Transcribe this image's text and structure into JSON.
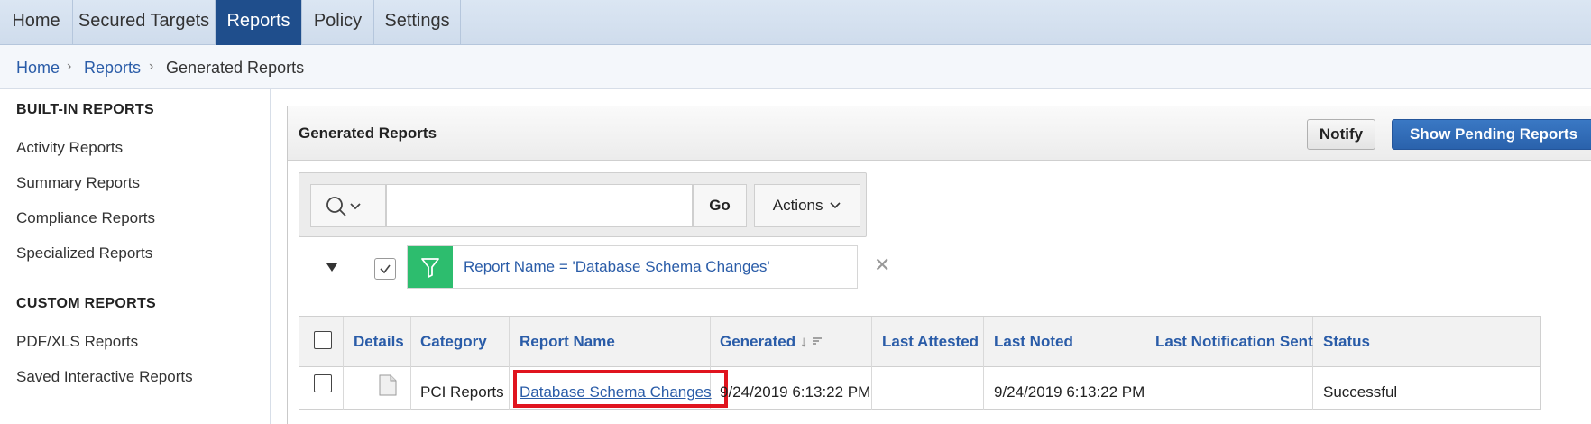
{
  "nav": {
    "tabs": [
      {
        "label": "Home",
        "active": false
      },
      {
        "label": "Secured Targets",
        "active": false
      },
      {
        "label": "Reports",
        "active": true
      },
      {
        "label": "Policy",
        "active": false
      },
      {
        "label": "Settings",
        "active": false
      }
    ]
  },
  "breadcrumb": {
    "items": [
      "Home",
      "Reports",
      "Generated Reports"
    ]
  },
  "sidebar": {
    "builtin_heading": "BUILT-IN REPORTS",
    "builtin_items": [
      "Activity Reports",
      "Summary Reports",
      "Compliance Reports",
      "Specialized Reports"
    ],
    "custom_heading": "CUSTOM REPORTS",
    "custom_items": [
      "PDF/XLS Reports",
      "Saved Interactive Reports"
    ]
  },
  "panel": {
    "title": "Generated Reports",
    "notify_label": "Notify",
    "pending_label": "Show Pending Reports"
  },
  "search": {
    "value": "",
    "go_label": "Go",
    "actions_label": "Actions"
  },
  "filter": {
    "checked": true,
    "text": "Report Name = 'Database Schema Changes'",
    "remove_glyph": "✕"
  },
  "table": {
    "columns": [
      "Details",
      "Category",
      "Report Name",
      "Generated",
      "Last Attested",
      "Last Noted",
      "Last Notification Sent",
      "Status"
    ],
    "sort_glyph": "↓",
    "rows": [
      {
        "category": "PCI Reports",
        "report_name": "Database Schema Changes",
        "generated": "9/24/2019 6:13:22 PM",
        "last_attested": "",
        "last_noted": "9/24/2019 6:13:22 PM",
        "last_notification_sent": "",
        "status": "Successful"
      }
    ]
  },
  "colors": {
    "nav_active": "#1f4e8c",
    "link": "#2a5ca8",
    "primary_button": "#2a62ac",
    "filter_green": "#2dbd6e",
    "highlight_red": "#e0141e"
  }
}
